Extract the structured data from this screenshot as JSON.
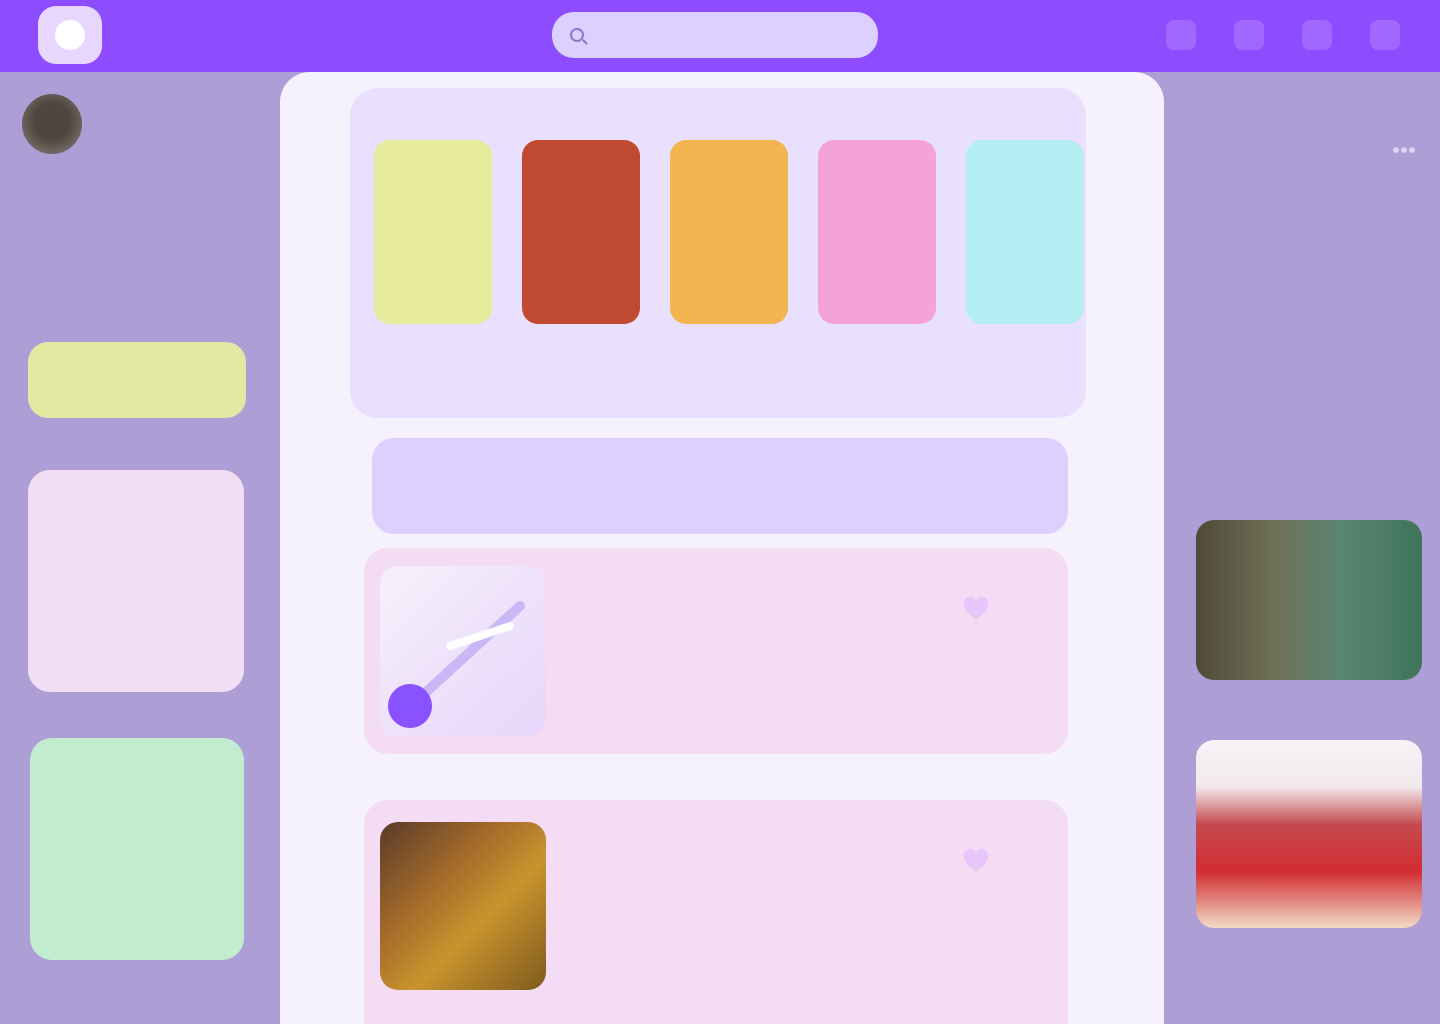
{
  "colors": {
    "topbar": "#8e4cff",
    "sidebar_bg": "#ad9fd6",
    "center_bg": "#f5f2fe",
    "accent_yellow": "#e3e8a3",
    "accent_pink": "#f1def4",
    "accent_green": "#c2ecd0",
    "accent_purple": "#8b4cff"
  },
  "header": {
    "search_placeholder": "",
    "icons": [
      "notification-icon",
      "message-icon",
      "settings-icon",
      "profile-icon"
    ]
  },
  "left_sidebar": {
    "profile_name": "",
    "profile_handle": "",
    "bio": "",
    "new_post_label": "",
    "pink_card_lines": [
      "",
      "",
      ""
    ],
    "green_card_lines": [
      "",
      "",
      ""
    ]
  },
  "stories": [
    {
      "label": "",
      "color": "#e6eb9b"
    },
    {
      "label": "",
      "color": "#c04a31"
    },
    {
      "label": "",
      "color": "#f2b54f"
    },
    {
      "label": "",
      "color": "#f5a2d8"
    },
    {
      "label": "",
      "color": "#b5eef2"
    }
  ],
  "composer_placeholder": "",
  "posts": [
    {
      "title": "",
      "body": "",
      "time": ""
    },
    {
      "title": "",
      "body": "",
      "time": ""
    }
  ],
  "right_sidebar": {
    "title": "",
    "description": "",
    "link_label": ""
  }
}
